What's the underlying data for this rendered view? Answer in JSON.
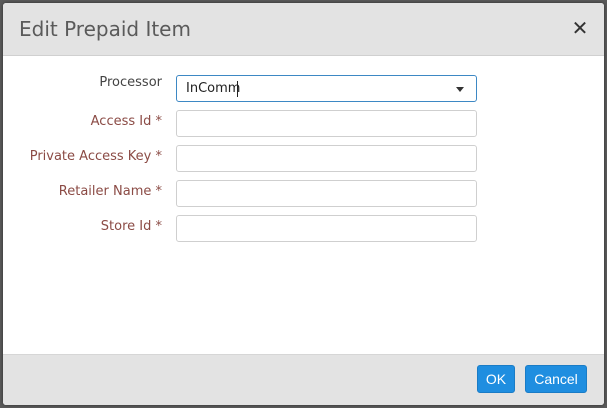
{
  "dialog": {
    "title": "Edit Prepaid Item",
    "close_glyph": "✕"
  },
  "form": {
    "processor": {
      "label": "Processor",
      "value": "InComm"
    },
    "access_id": {
      "label": "Access Id *",
      "value": ""
    },
    "private_access_key": {
      "label": "Private Access Key *",
      "value": ""
    },
    "retailer_name": {
      "label": "Retailer Name *",
      "value": ""
    },
    "store_id": {
      "label": "Store Id *",
      "value": ""
    }
  },
  "footer": {
    "ok_label": "OK",
    "cancel_label": "Cancel"
  },
  "colors": {
    "primary_button": "#1f8ee0",
    "required_label": "#8b4b45",
    "focus_border": "#3d88c4"
  },
  "icons": {
    "close": "close-icon",
    "dropdown": "chevron-down-icon"
  }
}
